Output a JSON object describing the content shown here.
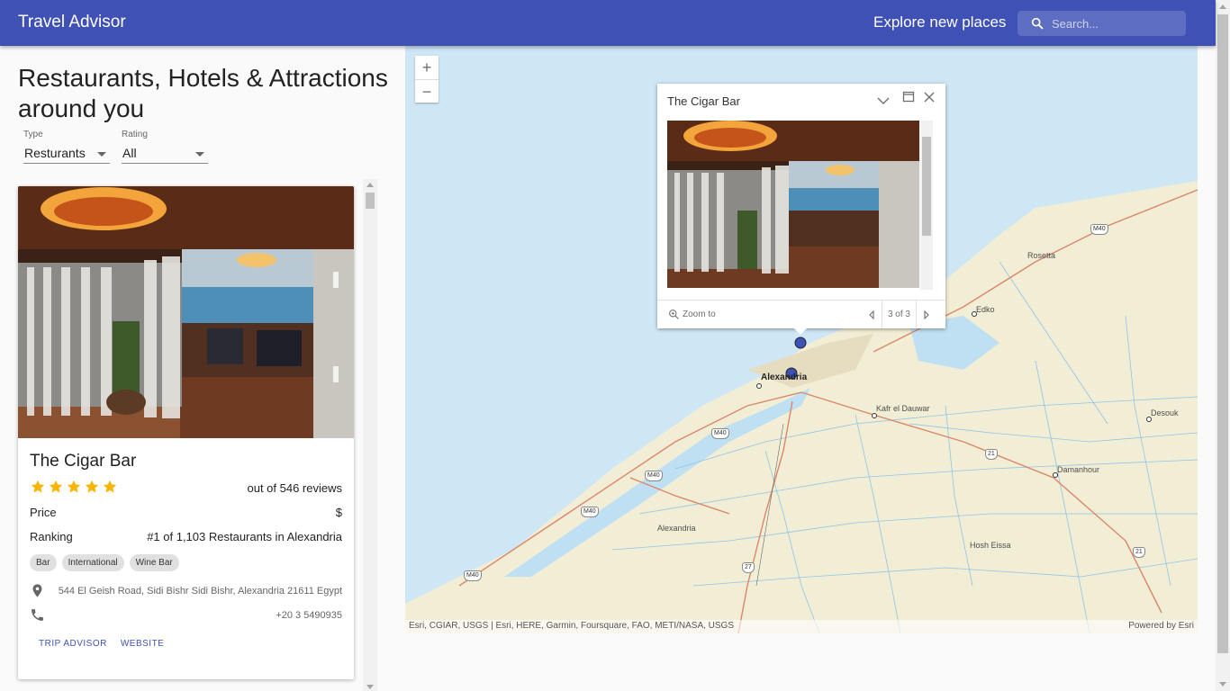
{
  "appbar": {
    "title": "Travel Advisor",
    "explore": "Explore new places",
    "search_placeholder": "Search..."
  },
  "heading": "Restaurants, Hotels & Attractions around you",
  "filters": {
    "type": {
      "label": "Type",
      "value": "Resturants"
    },
    "rating": {
      "label": "Rating",
      "value": "All"
    }
  },
  "card": {
    "name": "The Cigar Bar",
    "rating_stars": 5,
    "reviews": "out of 546 reviews",
    "price_label": "Price",
    "price_value": "$",
    "ranking_label": "Ranking",
    "ranking_value": "#1 of 1,103 Restaurants in Alexandria",
    "chips": [
      "Bar",
      "International",
      "Wine Bar"
    ],
    "address": "544 El Geish Road, Sidi Bishr Sidi Bishr, Alexandria 21611 Egypt",
    "phone": "+20 3 5490935",
    "actions": [
      "TRIP ADVISOR",
      "WEBSITE"
    ]
  },
  "map": {
    "zoom_in": "+",
    "zoom_out": "−",
    "attribution": "Esri, CGIAR, USGS | Esri, HERE, Garmin, Foursquare, FAO, METI/NASA, USGS",
    "powered_by": "Powered by Esri",
    "labels": {
      "alexandria": "Alexandria",
      "alexandria2": "Alexandria",
      "rosetta": "Rosetta",
      "edko": "Edko",
      "kafr": "Kafr el Dauwar",
      "desouk": "Desouk",
      "damanhour": "Damanhour",
      "hosh": "Hosh Eissa"
    },
    "shields": {
      "m40a": "M40",
      "m40b": "M40",
      "m40c": "M40",
      "m40d": "M40",
      "m40e": "M40",
      "r21a": "21",
      "r21b": "21",
      "r27": "27"
    },
    "colors": {
      "water": "#cfe7f5",
      "land": "#f2edd5",
      "road": "#d8876b",
      "canal": "#8fc5e8"
    }
  },
  "popup": {
    "title": "The Cigar Bar",
    "zoom_to": "Zoom to",
    "count": "3 of 3"
  }
}
